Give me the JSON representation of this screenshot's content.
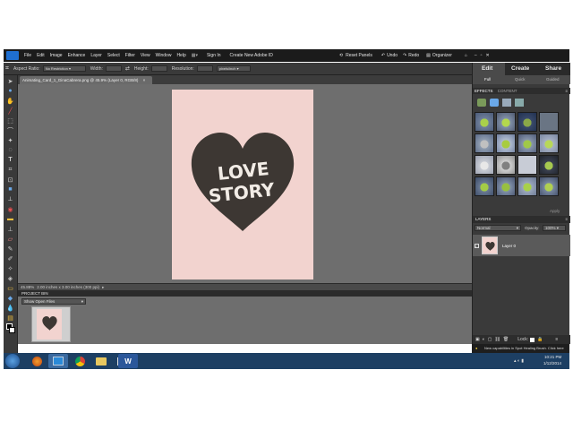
{
  "menu": {
    "items": [
      "File",
      "Edit",
      "Image",
      "Enhance",
      "Layer",
      "Select",
      "Filter",
      "View",
      "Window",
      "Help"
    ],
    "sign_in": "Sign In",
    "create_id": "Create New Adobe ID",
    "reset_panels": "Reset Panels",
    "undo": "Undo",
    "redo": "Redo",
    "organizer": "Organizer"
  },
  "options": {
    "aspect_label": "Aspect Ratio:",
    "aspect_value": "No Restriction",
    "width_label": "Width:",
    "height_label": "Height:",
    "resolution_label": "Resolution:",
    "units_value": "pixels/inch"
  },
  "document": {
    "tab_title": "Animating_Card_1_GinaCabrera.png @ 45.9% (Layer 0, RGB/8)",
    "zoom": "45.88%",
    "size_info": "2.00 inches x 3.00 inches (300 ppi)",
    "art_line1": "LOVE",
    "art_line2": "STORY",
    "art_color": "#f2d3cf",
    "heart_color": "#3d3733"
  },
  "project_bin": {
    "title": "PROJECT BIN",
    "filter": "Show Open Files"
  },
  "panel": {
    "modes": [
      "Edit",
      "Create",
      "Share"
    ],
    "subtabs": [
      "Full",
      "Quick",
      "Guided"
    ],
    "effects_tab": "EFFECTS",
    "content_tab": "CONTENT",
    "apply": "Apply",
    "layers_title": "LAYERS",
    "blend": "Normal",
    "opacity_label": "Opacity:",
    "opacity_value": "100%",
    "layer_name": "Layer 0",
    "lock_label": "Lock:"
  },
  "hint": "New capabilities in Spot Healing Brush. Click here",
  "taskbar": {
    "time": "10:21 PM",
    "date": "1/12/2014"
  }
}
